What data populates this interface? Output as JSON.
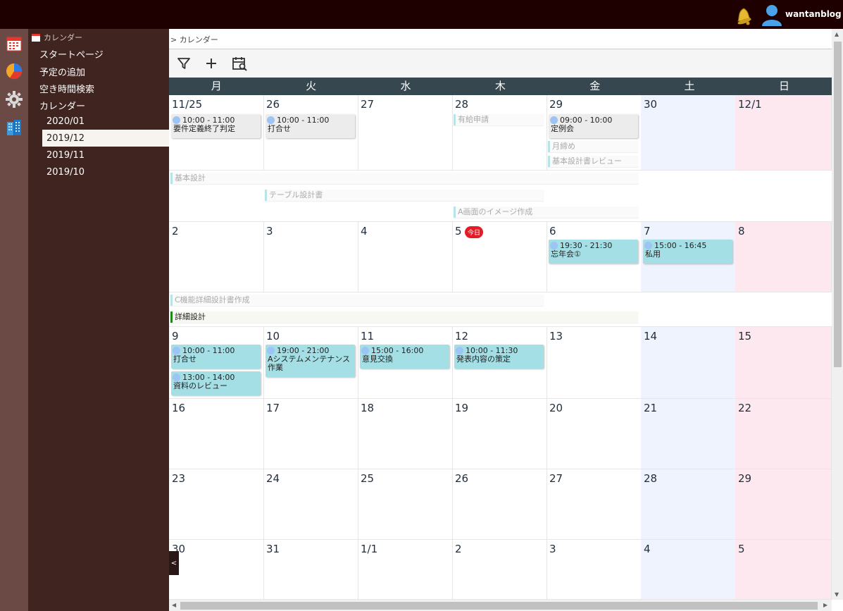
{
  "header": {
    "username": "wantanblog"
  },
  "sidebar": {
    "section_label": "カレンダー",
    "items": [
      "スタートページ",
      "予定の追加",
      "空き時間検索",
      "カレンダー"
    ],
    "months": [
      "2020/01",
      "2019/12",
      "2019/11",
      "2019/10"
    ],
    "active_month": "2019/12"
  },
  "breadcrumb": "> カレンダー",
  "collapse_label": "<",
  "weekdays": [
    "月",
    "火",
    "水",
    "木",
    "金",
    "土",
    "日"
  ],
  "today_label": "今日",
  "weeks": [
    [
      "11/25",
      "26",
      "27",
      "28",
      "29",
      "30",
      "12/1"
    ],
    [
      "2",
      "3",
      "4",
      "5",
      "6",
      "7",
      "8"
    ],
    [
      "9",
      "10",
      "11",
      "12",
      "13",
      "14",
      "15"
    ],
    [
      "16",
      "17",
      "18",
      "19",
      "20",
      "21",
      "22"
    ],
    [
      "23",
      "24",
      "25",
      "26",
      "27",
      "28",
      "29"
    ],
    [
      "30",
      "31",
      "1/1",
      "2",
      "3",
      "4",
      "5"
    ]
  ],
  "events": [
    {
      "time": "10:00 - 11:00",
      "name": "要件定義終了判定",
      "style": "grey"
    },
    {
      "time": "10:00 - 11:00",
      "name": "打合せ",
      "style": "grey"
    },
    {
      "time": "09:00 - 10:00",
      "name": "定例会",
      "style": "grey"
    },
    {
      "time": "19:30 - 21:30",
      "name": "忘年会①",
      "style": "cyan"
    },
    {
      "time": "15:00 - 16:45",
      "name": "私用",
      "style": "cyan"
    },
    {
      "time": "10:00 - 11:00",
      "name": "打合せ",
      "style": "cyan"
    },
    {
      "time": "13:00 - 14:00",
      "name": "資料のレビュー",
      "style": "cyan"
    },
    {
      "time": "19:00 - 21:00",
      "name": "Aシステムメンテナンス作業",
      "style": "cyan"
    },
    {
      "time": "15:00 - 16:00",
      "name": "意見交換",
      "style": "cyan"
    },
    {
      "time": "10:00 - 11:30",
      "name": "発表内容の策定",
      "style": "cyan"
    }
  ],
  "tasks": [
    "有給申請",
    "月締め",
    "基本設計書レビュー",
    "基本設計",
    "テーブル設計書",
    "A画面のイメージ作成",
    "C機能詳細設計書作成",
    "詳細設計"
  ]
}
